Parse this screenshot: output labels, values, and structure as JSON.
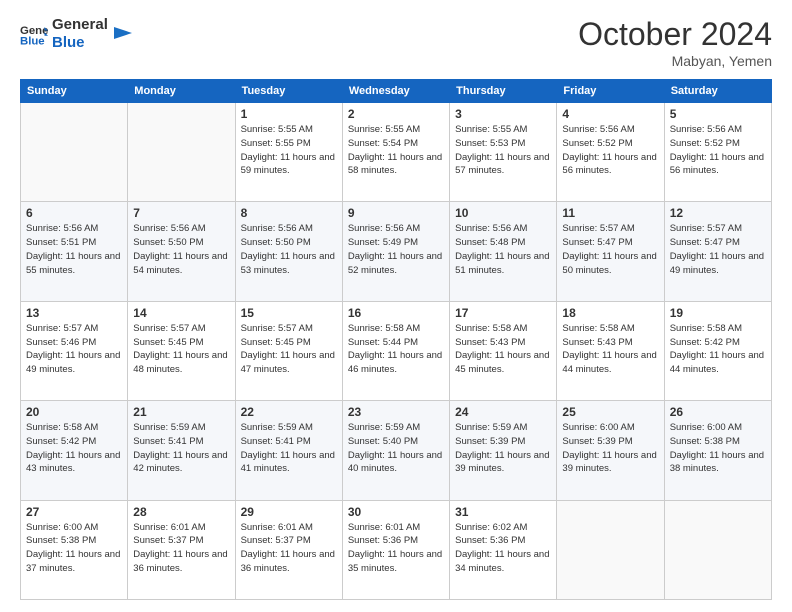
{
  "header": {
    "logo_line1": "General",
    "logo_line2": "Blue",
    "month": "October 2024",
    "location": "Mabyan, Yemen"
  },
  "weekdays": [
    "Sunday",
    "Monday",
    "Tuesday",
    "Wednesday",
    "Thursday",
    "Friday",
    "Saturday"
  ],
  "weeks": [
    [
      {
        "day": "",
        "info": ""
      },
      {
        "day": "",
        "info": ""
      },
      {
        "day": "1",
        "info": "Sunrise: 5:55 AM\nSunset: 5:55 PM\nDaylight: 11 hours and 59 minutes."
      },
      {
        "day": "2",
        "info": "Sunrise: 5:55 AM\nSunset: 5:54 PM\nDaylight: 11 hours and 58 minutes."
      },
      {
        "day": "3",
        "info": "Sunrise: 5:55 AM\nSunset: 5:53 PM\nDaylight: 11 hours and 57 minutes."
      },
      {
        "day": "4",
        "info": "Sunrise: 5:56 AM\nSunset: 5:52 PM\nDaylight: 11 hours and 56 minutes."
      },
      {
        "day": "5",
        "info": "Sunrise: 5:56 AM\nSunset: 5:52 PM\nDaylight: 11 hours and 56 minutes."
      }
    ],
    [
      {
        "day": "6",
        "info": "Sunrise: 5:56 AM\nSunset: 5:51 PM\nDaylight: 11 hours and 55 minutes."
      },
      {
        "day": "7",
        "info": "Sunrise: 5:56 AM\nSunset: 5:50 PM\nDaylight: 11 hours and 54 minutes."
      },
      {
        "day": "8",
        "info": "Sunrise: 5:56 AM\nSunset: 5:50 PM\nDaylight: 11 hours and 53 minutes."
      },
      {
        "day": "9",
        "info": "Sunrise: 5:56 AM\nSunset: 5:49 PM\nDaylight: 11 hours and 52 minutes."
      },
      {
        "day": "10",
        "info": "Sunrise: 5:56 AM\nSunset: 5:48 PM\nDaylight: 11 hours and 51 minutes."
      },
      {
        "day": "11",
        "info": "Sunrise: 5:57 AM\nSunset: 5:47 PM\nDaylight: 11 hours and 50 minutes."
      },
      {
        "day": "12",
        "info": "Sunrise: 5:57 AM\nSunset: 5:47 PM\nDaylight: 11 hours and 49 minutes."
      }
    ],
    [
      {
        "day": "13",
        "info": "Sunrise: 5:57 AM\nSunset: 5:46 PM\nDaylight: 11 hours and 49 minutes."
      },
      {
        "day": "14",
        "info": "Sunrise: 5:57 AM\nSunset: 5:45 PM\nDaylight: 11 hours and 48 minutes."
      },
      {
        "day": "15",
        "info": "Sunrise: 5:57 AM\nSunset: 5:45 PM\nDaylight: 11 hours and 47 minutes."
      },
      {
        "day": "16",
        "info": "Sunrise: 5:58 AM\nSunset: 5:44 PM\nDaylight: 11 hours and 46 minutes."
      },
      {
        "day": "17",
        "info": "Sunrise: 5:58 AM\nSunset: 5:43 PM\nDaylight: 11 hours and 45 minutes."
      },
      {
        "day": "18",
        "info": "Sunrise: 5:58 AM\nSunset: 5:43 PM\nDaylight: 11 hours and 44 minutes."
      },
      {
        "day": "19",
        "info": "Sunrise: 5:58 AM\nSunset: 5:42 PM\nDaylight: 11 hours and 44 minutes."
      }
    ],
    [
      {
        "day": "20",
        "info": "Sunrise: 5:58 AM\nSunset: 5:42 PM\nDaylight: 11 hours and 43 minutes."
      },
      {
        "day": "21",
        "info": "Sunrise: 5:59 AM\nSunset: 5:41 PM\nDaylight: 11 hours and 42 minutes."
      },
      {
        "day": "22",
        "info": "Sunrise: 5:59 AM\nSunset: 5:41 PM\nDaylight: 11 hours and 41 minutes."
      },
      {
        "day": "23",
        "info": "Sunrise: 5:59 AM\nSunset: 5:40 PM\nDaylight: 11 hours and 40 minutes."
      },
      {
        "day": "24",
        "info": "Sunrise: 5:59 AM\nSunset: 5:39 PM\nDaylight: 11 hours and 39 minutes."
      },
      {
        "day": "25",
        "info": "Sunrise: 6:00 AM\nSunset: 5:39 PM\nDaylight: 11 hours and 39 minutes."
      },
      {
        "day": "26",
        "info": "Sunrise: 6:00 AM\nSunset: 5:38 PM\nDaylight: 11 hours and 38 minutes."
      }
    ],
    [
      {
        "day": "27",
        "info": "Sunrise: 6:00 AM\nSunset: 5:38 PM\nDaylight: 11 hours and 37 minutes."
      },
      {
        "day": "28",
        "info": "Sunrise: 6:01 AM\nSunset: 5:37 PM\nDaylight: 11 hours and 36 minutes."
      },
      {
        "day": "29",
        "info": "Sunrise: 6:01 AM\nSunset: 5:37 PM\nDaylight: 11 hours and 36 minutes."
      },
      {
        "day": "30",
        "info": "Sunrise: 6:01 AM\nSunset: 5:36 PM\nDaylight: 11 hours and 35 minutes."
      },
      {
        "day": "31",
        "info": "Sunrise: 6:02 AM\nSunset: 5:36 PM\nDaylight: 11 hours and 34 minutes."
      },
      {
        "day": "",
        "info": ""
      },
      {
        "day": "",
        "info": ""
      }
    ]
  ]
}
